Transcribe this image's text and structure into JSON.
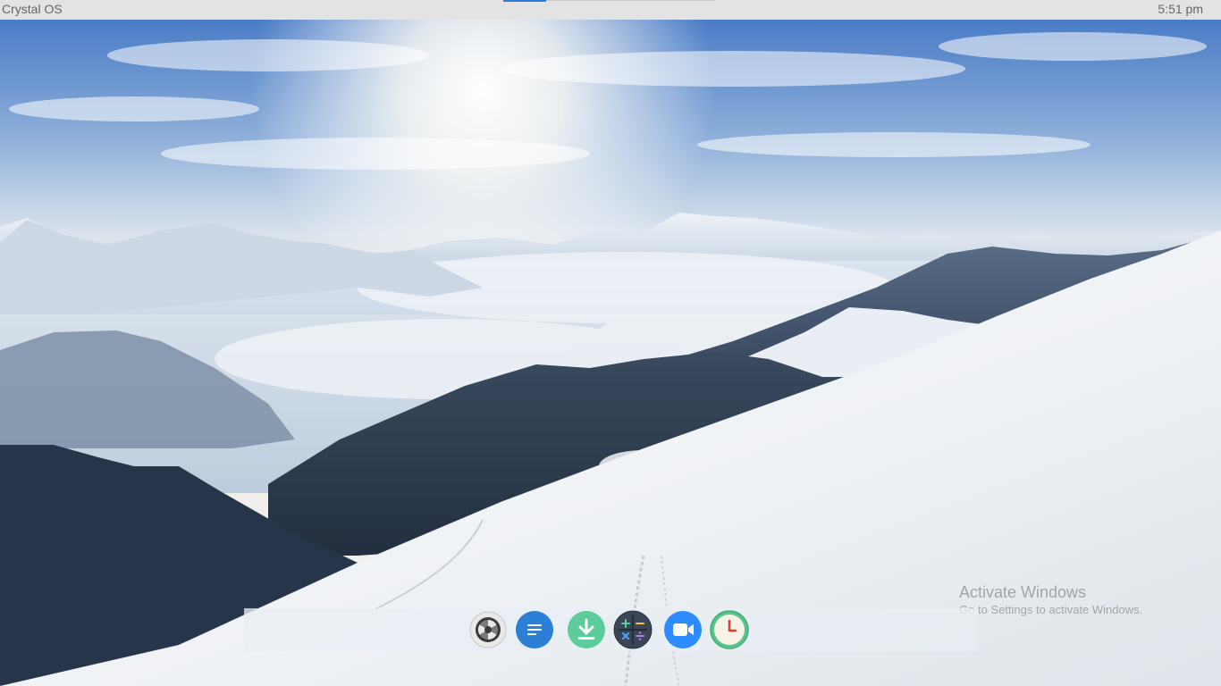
{
  "top_bar": {
    "os_name": "Crystal OS",
    "clock": "5:51 pm",
    "accent_color": "#2f7bd6"
  },
  "wallpaper": {
    "description_colors": {
      "sky_top": "#3f74c2",
      "sky_bottom": "#f3ede2",
      "snow": "#f2f4f6",
      "mountain_dark": "#2b3a4e"
    }
  },
  "dock": {
    "apps": [
      {
        "icon": "system-settings-icon",
        "color": "#e9e9e9"
      },
      {
        "icon": "text-editor-icon",
        "color": "#2b7fd4"
      },
      {
        "icon": "download-icon",
        "color": "#5ccd9a"
      },
      {
        "icon": "calculator-icon",
        "color": "#3a4656"
      },
      {
        "icon": "video-camera-icon",
        "color": "#2d8cff"
      },
      {
        "icon": "clock-icon",
        "color": "#58c48a"
      }
    ]
  },
  "watermark": {
    "title": "Activate Windows",
    "subtitle": "Go to Settings to activate Windows."
  }
}
